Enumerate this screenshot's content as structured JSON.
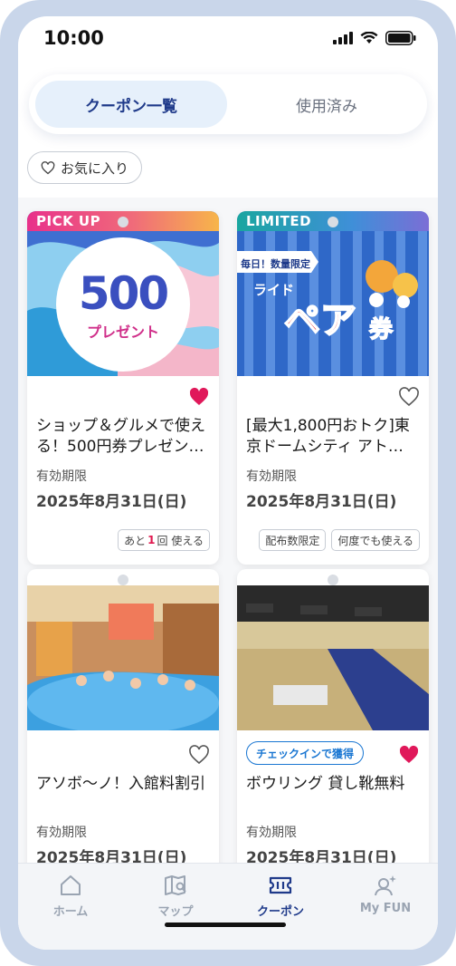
{
  "status": {
    "time": "10:00"
  },
  "tabs": {
    "active": "クーポン一覧",
    "inactive": "使用済み"
  },
  "filter": {
    "favorites_label": "お気に入り"
  },
  "cards": [
    {
      "ribbon": "PICK UP",
      "image_text_big": "500",
      "image_text_sub": "プレゼント",
      "title": "ショップ＆グルメで使える！500円券プレゼン…",
      "validity_label": "有効期限",
      "date": "2025年8月31日(日)",
      "chip_prefix": "あと",
      "chip_count": "1",
      "chip_suffix": "回 使える",
      "favorited": true
    },
    {
      "ribbon": "LIMITED",
      "image_tag": "毎日！数量限定",
      "image_text_ride": "ライド",
      "image_text_pair": "ペア",
      "image_text_ken": "券",
      "title": "[最大1,800円おトク]東京ドームシティ アト…",
      "validity_label": "有効期限",
      "date": "2025年8月31日(日)",
      "chips": [
        "配布数限定",
        "何度でも使える"
      ],
      "favorited": false
    },
    {
      "title": "アソボ〜ノ！入館料割引",
      "validity_label": "有効期限",
      "date": "2025年8月31日(日)",
      "favorited": false
    },
    {
      "badge": "チェックインで獲得",
      "title": "ボウリング 貸し靴無料",
      "validity_label": "有効期限",
      "date": "2025年8月31日(日)",
      "favorited": true
    }
  ],
  "nav": [
    {
      "label": "ホーム",
      "icon": "home-icon"
    },
    {
      "label": "マップ",
      "icon": "map-icon"
    },
    {
      "label": "クーポン",
      "icon": "coupon-icon",
      "active": true
    },
    {
      "label": "My FUN",
      "icon": "user-sparkle-icon"
    }
  ],
  "colors": {
    "accent": "#1f3a8a",
    "heart": "#e0185a",
    "inactive": "#9aa4b2",
    "frame": "#c9d6ea"
  }
}
